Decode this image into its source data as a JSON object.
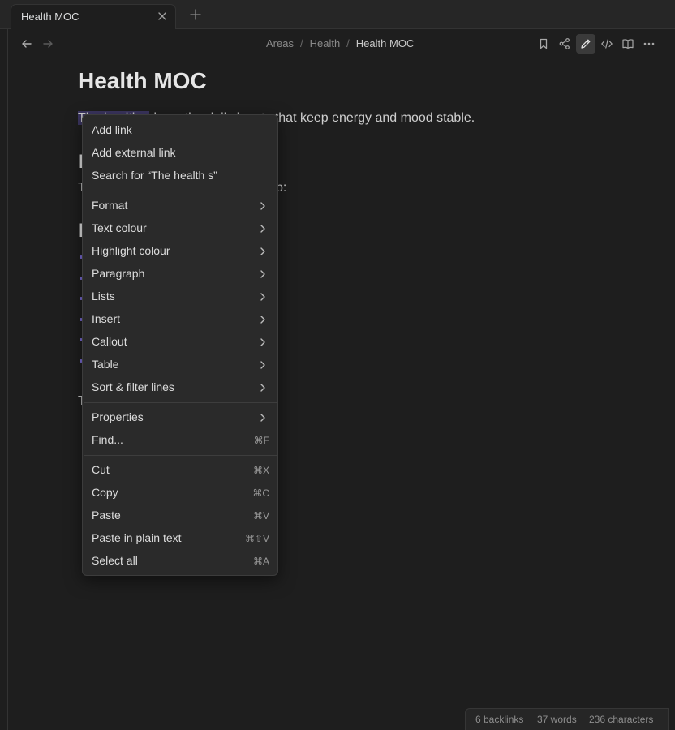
{
  "tab": {
    "title": "Health MOC"
  },
  "breadcrumb": {
    "items": [
      "Areas",
      "Health"
    ],
    "current": "Health MOC",
    "separator": "/"
  },
  "note": {
    "title": "Health MOC",
    "para_selected": "The health s",
    "para_rest": "ds on the daily inputs that keep energy and mood stable.",
    "frag_h2_a": "I",
    "frag_line2_start": "T",
    "frag_line2_end": "p:",
    "frag_h2_b": "I",
    "frag_line3": "T"
  },
  "menu": {
    "group1": [
      "Add link",
      "Add external link",
      "Search for “The health s”"
    ],
    "group2": [
      "Format",
      "Text colour",
      "Highlight colour",
      "Paragraph",
      "Lists",
      "Insert",
      "Callout",
      "Table",
      "Sort & filter lines"
    ],
    "properties": "Properties",
    "find": {
      "label": "Find...",
      "shortcut": "⌘F"
    },
    "cut": {
      "label": "Cut",
      "shortcut": "⌘X"
    },
    "copy": {
      "label": "Copy",
      "shortcut": "⌘C"
    },
    "paste": {
      "label": "Paste",
      "shortcut": "⌘V"
    },
    "paste_plain": {
      "label": "Paste in plain text",
      "shortcut": "⌘⇧V"
    },
    "select_all": {
      "label": "Select all",
      "shortcut": "⌘A"
    }
  },
  "status": {
    "backlinks": "6 backlinks",
    "words": "37 words",
    "characters": "236 characters"
  },
  "colors": {
    "accent": "#7b6cd9",
    "selection": "#3b3560",
    "menu_bg": "#2a2a2a"
  }
}
